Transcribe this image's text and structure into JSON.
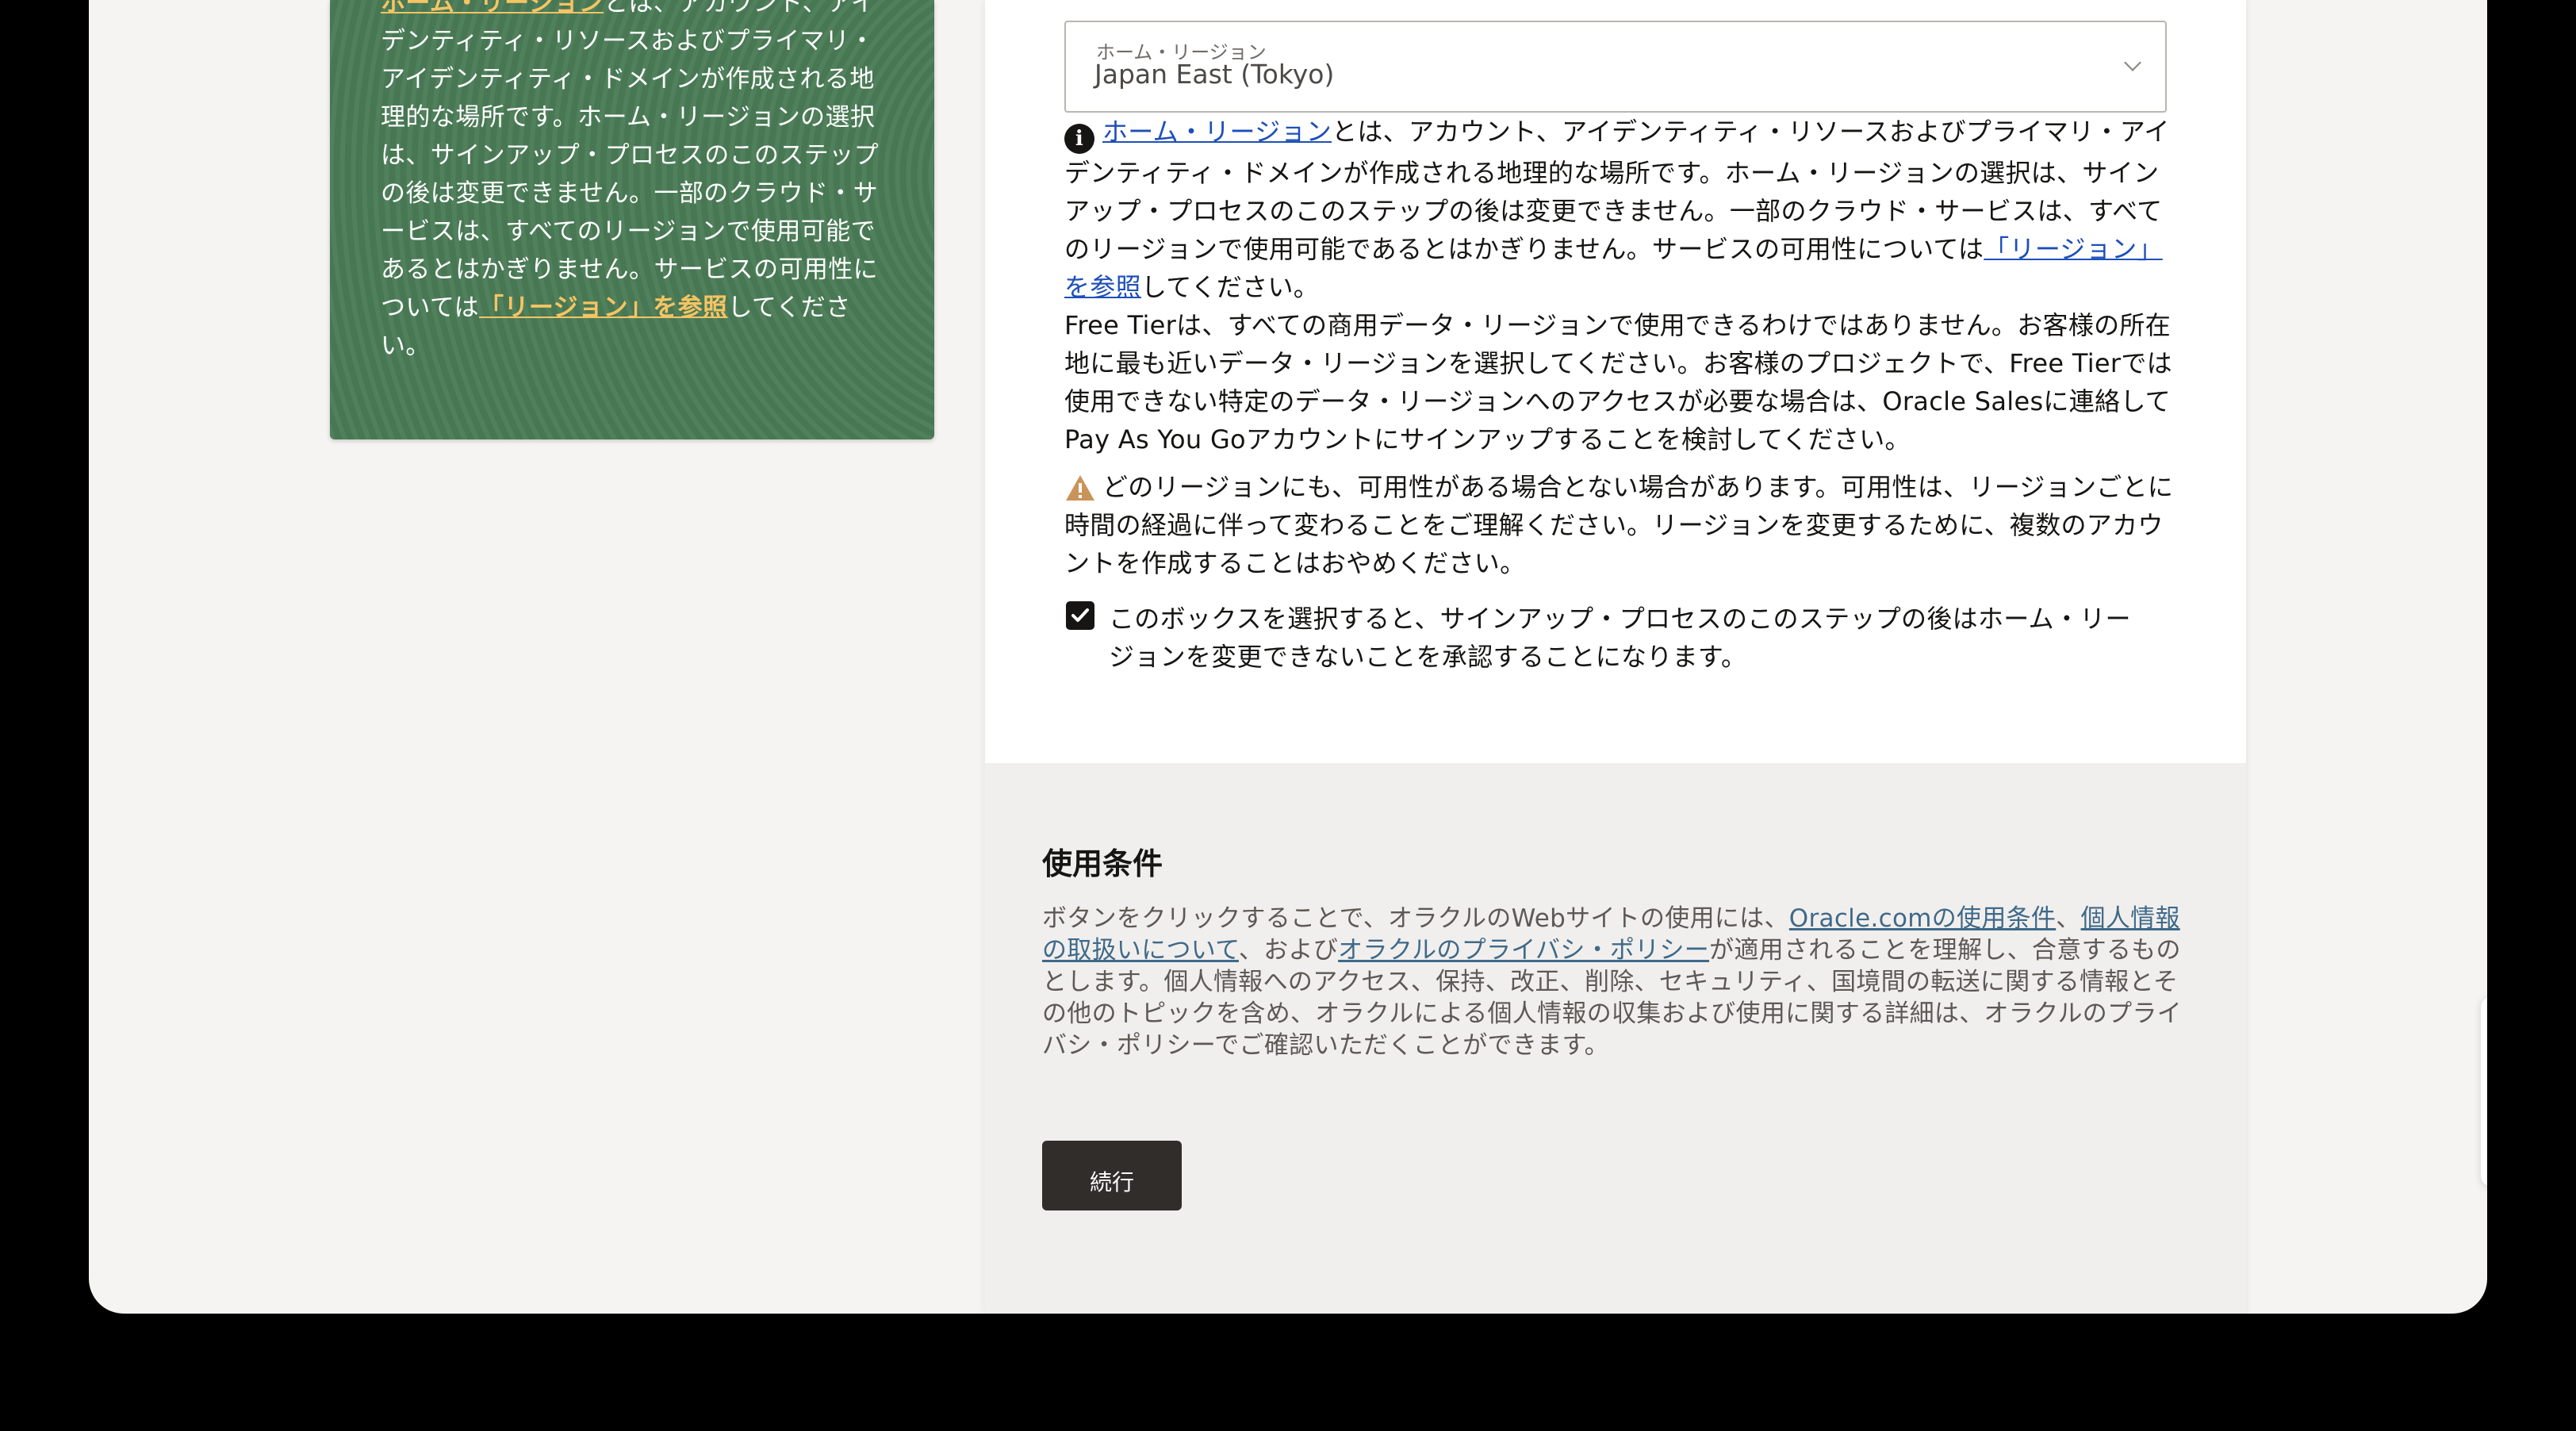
{
  "left_panel": {
    "link_home_region": "ホーム・リージョン",
    "text_1": "とは、アカウント、アイデンティティ・リソースおよびプライマリ・アイデンティティ・ドメインが作成される地理的な場所です。ホーム・リージョンの選択は、サインアップ・プロセスのこのステップの後は変更できません。一部のクラウド・サービスは、すべてのリージョンで使用可能であるとはかぎりません。サービスの可用性については",
    "link_regions": "「リージョン」を参照",
    "text_2": "してください。"
  },
  "region_select": {
    "label": "ホーム・リージョン",
    "value": "Japan East (Tokyo)"
  },
  "info": {
    "link_home_region": "ホーム・リージョン",
    "text_1": "とは、アカウント、アイデンティティ・リソースおよびプライマリ・アイデンティティ・ドメインが作成される地理的な場所です。ホーム・リージョンの選択は、サインアップ・プロセスのこのステップの後は変更できません。一部のクラウド・サービスは、すべてのリージョンで使用可能であるとはかぎりません。サービスの可用性については",
    "link_regions": "「リージョン」を参照",
    "text_2": "してください。",
    "free_tier": "Free Tierは、すべての商用データ・リージョンで使用できるわけではありません。お客様の所在地に最も近いデータ・リージョンを選択してください。お客様のプロジェクトで、Free Tierでは使用できない特定のデータ・リージョンへのアクセスが必要な場合は、Oracle Salesに連絡してPay As You Goアカウントにサインアップすることを検討してください。"
  },
  "warning": {
    "text": "どのリージョンにも、可用性がある場合とない場合があります。可用性は、リージョンごとに時間の経過に伴って変わることをご理解ください。リージョンを変更するために、複数のアカウントを作成することはおやめください。"
  },
  "acknowledge": {
    "checked": true,
    "label": "このボックスを選択すると、サインアップ・プロセスのこのステップの後はホーム・リージョンを変更できないことを承認することになります。"
  },
  "terms": {
    "title": "使用条件",
    "text_1": "ボタンをクリックすることで、オラクルのWebサイトの使用には、",
    "link_terms": "Oracle.comの使用条件",
    "sep_1": "、",
    "link_personal": "個人情報の取扱いについて",
    "sep_2": "、および",
    "link_privacy": "オラクルのプライバシ・ポリシー",
    "text_2": "が適用されることを理解し、合意するものとします。個人情報へのアクセス、保持、改正、削除、セキュリティ、国境間の転送に関する情報とその他のトピックを含め、オラクルによる個人情報の収集および使用に関する詳細は、オラクルのプライバシ・ポリシーでご確認いただくことができます。",
    "continue_label": "続行"
  },
  "widget": {
    "chat_icon": "chat-icon",
    "phone_icon": "phone-icon",
    "accent_color": "#c74634"
  },
  "colors": {
    "panel_green": "#4a7b56",
    "panel_link": "#f6c463",
    "link_blue": "#1d4fb8",
    "button_dark": "#312d2a"
  }
}
